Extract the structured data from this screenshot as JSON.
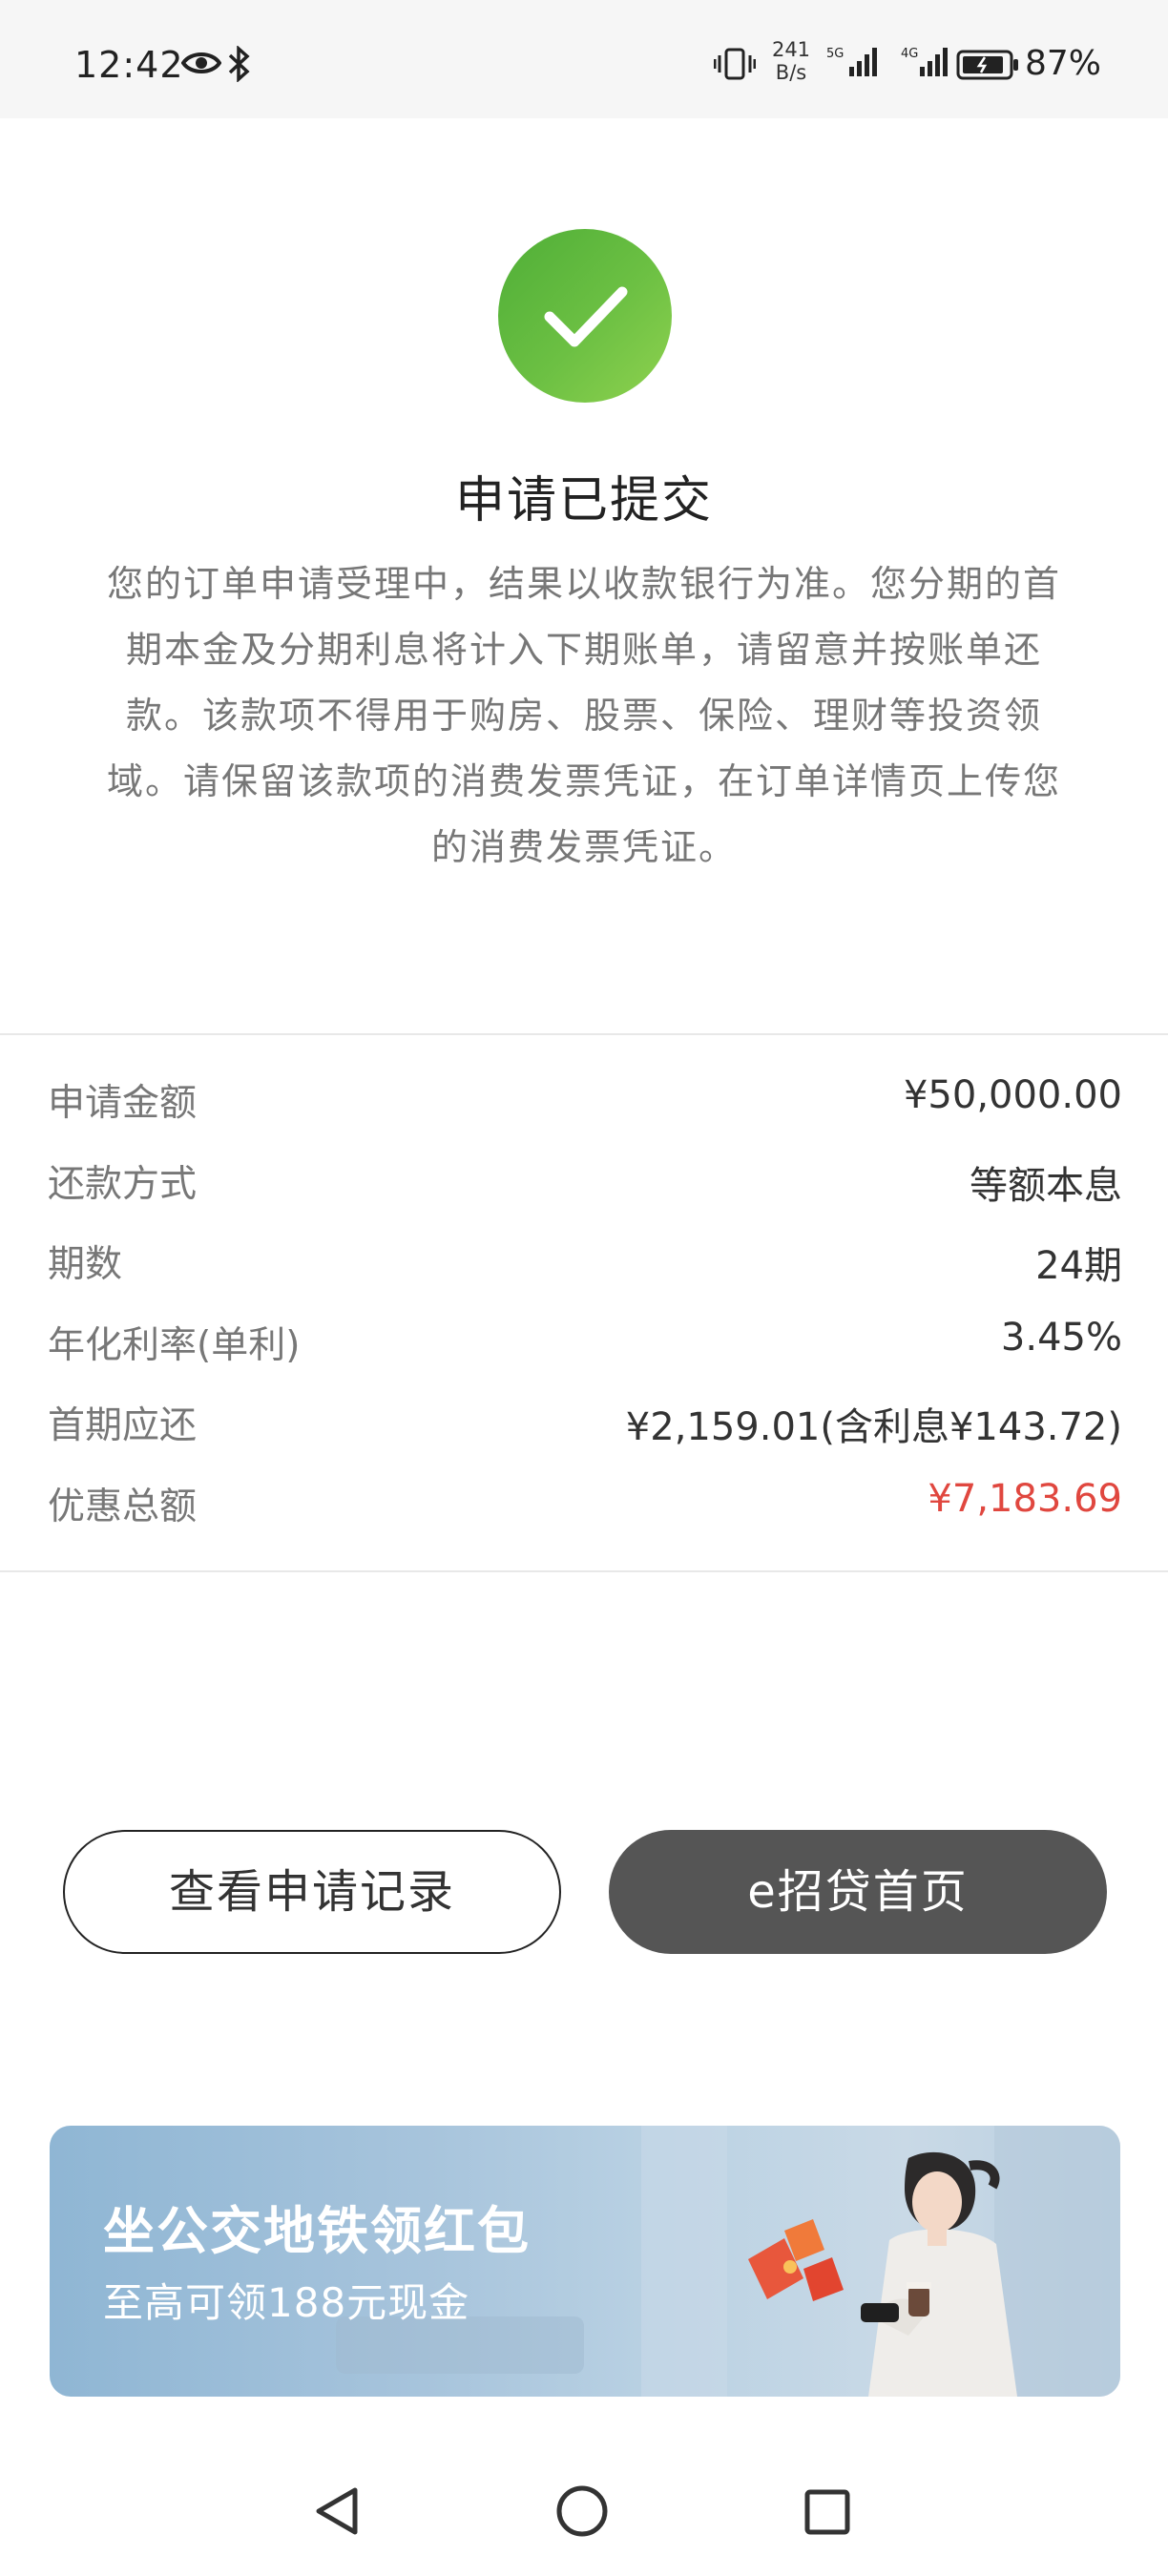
{
  "status_bar": {
    "time": "12:42",
    "net_speed_value": "241",
    "net_speed_unit": "B/s",
    "battery": "87%",
    "icons": [
      "eye-icon",
      "bluetooth-icon",
      "vibrate-icon",
      "signal-5g-icon",
      "signal-4g-icon",
      "battery-icon"
    ]
  },
  "result": {
    "title": "申请已提交",
    "description": "您的订单申请受理中，结果以收款银行为准。您分期的首期本金及分期利息将计入下期账单，请留意并按账单还款。该款项不得用于购房、股票、保险、理财等投资领域。请保留该款项的消费发票凭证，在订单详情页上传您的消费发票凭证。",
    "icon": "check-icon",
    "icon_color": "#6cc043"
  },
  "details": [
    {
      "label": "申请金额",
      "value": "¥50,000.00"
    },
    {
      "label": "还款方式",
      "value": "等额本息"
    },
    {
      "label": "期数",
      "value": "24期"
    },
    {
      "label": "年化利率(单利)",
      "value": "3.45%"
    },
    {
      "label": "首期应还",
      "value": "¥2,159.01(含利息¥143.72)"
    },
    {
      "label": "优惠总额",
      "value": "¥7,183.69",
      "color": "#e0473f"
    }
  ],
  "buttons": {
    "records": "查看申请记录",
    "home": "e招贷首页"
  },
  "banner": {
    "title": "坐公交地铁领红包",
    "subtitle": "至高可领188元现金"
  },
  "nav": {
    "icons": [
      "back-icon",
      "home-icon",
      "recent-apps-icon"
    ]
  }
}
